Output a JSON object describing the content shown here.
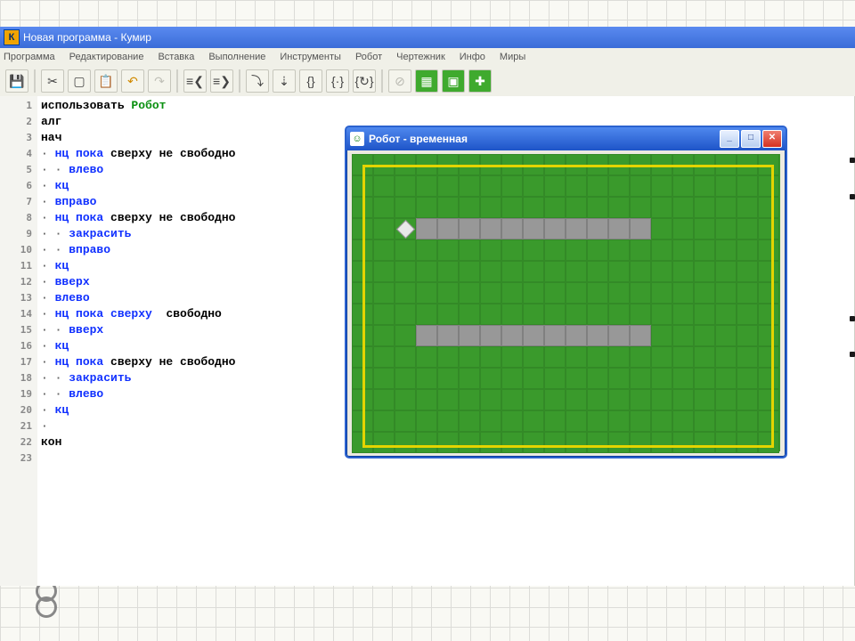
{
  "title": "Новая программа - Кумир",
  "menu": [
    "Программа",
    "Редактирование",
    "Вставка",
    "Выполнение",
    "Инструменты",
    "Робот",
    "Чертежник",
    "Инфо",
    "Миры"
  ],
  "toolbar": [
    {
      "id": "save",
      "glyph": "💾"
    },
    {
      "id": "cut",
      "glyph": "✂"
    },
    {
      "id": "copy",
      "glyph": "▢"
    },
    {
      "id": "paste",
      "glyph": "📋"
    },
    {
      "id": "undo",
      "glyph": "↶",
      "color": "#d18a00"
    },
    {
      "id": "redo",
      "glyph": "↷",
      "color": "#c0c0b8"
    },
    {
      "id": "indent-left",
      "glyph": "≡❮"
    },
    {
      "id": "indent-right",
      "glyph": "≡❯"
    },
    {
      "id": "step-into",
      "glyph": "⤵"
    },
    {
      "id": "step-over",
      "glyph": "⇣"
    },
    {
      "id": "br1",
      "glyph": "{}"
    },
    {
      "id": "br2",
      "glyph": "{·}"
    },
    {
      "id": "br3",
      "glyph": "{↻}"
    },
    {
      "id": "stop",
      "glyph": "⊘",
      "color": "#b8b8b0"
    },
    {
      "id": "grid",
      "glyph": "▦",
      "green": true
    },
    {
      "id": "panel",
      "glyph": "▣",
      "green": true
    },
    {
      "id": "plus",
      "glyph": "✚",
      "green": true
    }
  ],
  "code": [
    {
      "n": 1,
      "tokens": [
        {
          "t": "использовать ",
          "c": "plain"
        },
        {
          "t": "Робот",
          "c": "kw-obj"
        }
      ]
    },
    {
      "n": 2,
      "tokens": [
        {
          "t": "алг",
          "c": "plain"
        }
      ]
    },
    {
      "n": 3,
      "tokens": [
        {
          "t": "нач",
          "c": "plain"
        }
      ]
    },
    {
      "n": 4,
      "tokens": [
        {
          "t": "· ",
          "c": "dot"
        },
        {
          "t": "нц пока",
          "c": "kw"
        },
        {
          "t": " сверху не свободно",
          "c": "plain"
        }
      ]
    },
    {
      "n": 5,
      "tokens": [
        {
          "t": "· · ",
          "c": "dot"
        },
        {
          "t": "влево",
          "c": "kw"
        }
      ]
    },
    {
      "n": 6,
      "tokens": [
        {
          "t": "· ",
          "c": "dot"
        },
        {
          "t": "кц",
          "c": "kw"
        }
      ]
    },
    {
      "n": 7,
      "tokens": [
        {
          "t": "· ",
          "c": "dot"
        },
        {
          "t": "вправо",
          "c": "kw"
        }
      ]
    },
    {
      "n": 8,
      "tokens": [
        {
          "t": "· ",
          "c": "dot"
        },
        {
          "t": "нц пока",
          "c": "kw"
        },
        {
          "t": " сверху не свободно",
          "c": "plain"
        }
      ]
    },
    {
      "n": 9,
      "tokens": [
        {
          "t": "· · ",
          "c": "dot"
        },
        {
          "t": "закрасить",
          "c": "kw"
        }
      ]
    },
    {
      "n": 10,
      "tokens": [
        {
          "t": "· · ",
          "c": "dot"
        },
        {
          "t": "вправо",
          "c": "kw"
        }
      ]
    },
    {
      "n": 11,
      "tokens": [
        {
          "t": "· ",
          "c": "dot"
        },
        {
          "t": "кц",
          "c": "kw"
        }
      ]
    },
    {
      "n": 12,
      "tokens": [
        {
          "t": "· ",
          "c": "dot"
        },
        {
          "t": "вверх",
          "c": "kw"
        }
      ]
    },
    {
      "n": 13,
      "tokens": [
        {
          "t": "· ",
          "c": "dot"
        },
        {
          "t": "влево",
          "c": "kw"
        }
      ]
    },
    {
      "n": 14,
      "tokens": [
        {
          "t": "· ",
          "c": "dot"
        },
        {
          "t": "нц пока",
          "c": "kw"
        },
        {
          "t": " ",
          "c": "plain"
        },
        {
          "t": "сверху",
          "c": "kw"
        },
        {
          "t": "  свободно",
          "c": "plain"
        }
      ]
    },
    {
      "n": 15,
      "tokens": [
        {
          "t": "· · ",
          "c": "dot"
        },
        {
          "t": "вверх",
          "c": "kw"
        }
      ]
    },
    {
      "n": 16,
      "tokens": [
        {
          "t": "· ",
          "c": "dot"
        },
        {
          "t": "кц",
          "c": "kw"
        }
      ]
    },
    {
      "n": 17,
      "tokens": [
        {
          "t": "· ",
          "c": "dot"
        },
        {
          "t": "нц пока",
          "c": "kw"
        },
        {
          "t": " сверху не свободно",
          "c": "plain"
        }
      ]
    },
    {
      "n": 18,
      "tokens": [
        {
          "t": "· · ",
          "c": "dot"
        },
        {
          "t": "закрасить",
          "c": "kw"
        }
      ]
    },
    {
      "n": 19,
      "tokens": [
        {
          "t": "· · ",
          "c": "dot"
        },
        {
          "t": "влево",
          "c": "kw"
        }
      ]
    },
    {
      "n": 20,
      "tokens": [
        {
          "t": "· ",
          "c": "dot"
        },
        {
          "t": "кц",
          "c": "kw"
        }
      ]
    },
    {
      "n": 21,
      "tokens": [
        {
          "t": "·",
          "c": "dot"
        }
      ]
    },
    {
      "n": 22,
      "tokens": [
        {
          "t": "кон",
          "c": "plain"
        }
      ]
    },
    {
      "n": 23,
      "tokens": []
    }
  ],
  "robot": {
    "title": "Робот - временная",
    "cols": 20,
    "rows": 14,
    "cell": 24,
    "gray": [
      {
        "r": 3,
        "c": 3
      },
      {
        "r": 3,
        "c": 4
      },
      {
        "r": 3,
        "c": 5
      },
      {
        "r": 3,
        "c": 6
      },
      {
        "r": 3,
        "c": 7
      },
      {
        "r": 3,
        "c": 8
      },
      {
        "r": 3,
        "c": 9
      },
      {
        "r": 3,
        "c": 10
      },
      {
        "r": 3,
        "c": 11
      },
      {
        "r": 3,
        "c": 12
      },
      {
        "r": 3,
        "c": 13
      },
      {
        "r": 8,
        "c": 3
      },
      {
        "r": 8,
        "c": 4
      },
      {
        "r": 8,
        "c": 5
      },
      {
        "r": 8,
        "c": 6
      },
      {
        "r": 8,
        "c": 7
      },
      {
        "r": 8,
        "c": 8
      },
      {
        "r": 8,
        "c": 9
      },
      {
        "r": 8,
        "c": 10
      },
      {
        "r": 8,
        "c": 11
      },
      {
        "r": 8,
        "c": 12
      },
      {
        "r": 8,
        "c": 13
      }
    ],
    "robotPos": {
      "r": 3,
      "c": 2
    }
  }
}
